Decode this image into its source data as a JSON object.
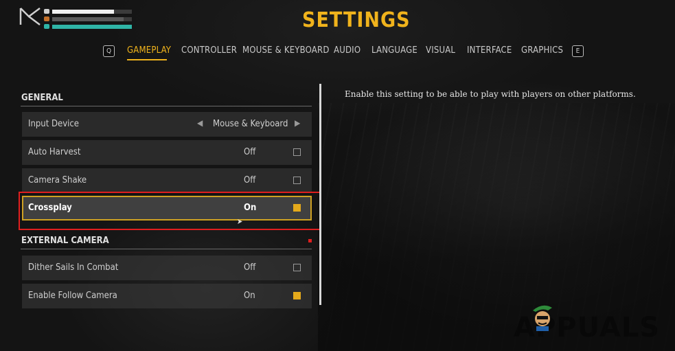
{
  "title": "SETTINGS",
  "tabs": {
    "prev_key": "Q",
    "next_key": "E",
    "items": [
      "GAMEPLAY",
      "CONTROLLER",
      "MOUSE & KEYBOARD",
      "AUDIO",
      "LANGUAGE",
      "VISUAL",
      "INTERFACE",
      "GRAPHICS"
    ],
    "active": "GAMEPLAY"
  },
  "sections": [
    {
      "header": "GENERAL",
      "rows": [
        {
          "label": "Input Device",
          "value": "Mouse & Keyboard",
          "type": "selector"
        },
        {
          "label": "Auto Harvest",
          "value": "Off",
          "type": "toggle",
          "checked": false
        },
        {
          "label": "Camera Shake",
          "value": "Off",
          "type": "toggle",
          "checked": false
        },
        {
          "label": "Crossplay",
          "value": "On",
          "type": "toggle",
          "checked": true,
          "selected": true
        }
      ]
    },
    {
      "header": "EXTERNAL CAMERA",
      "rows": [
        {
          "label": "Dither Sails In Combat",
          "value": "Off",
          "type": "toggle",
          "checked": false
        },
        {
          "label": "Enable Follow Camera",
          "value": "On",
          "type": "toggle",
          "checked": true
        }
      ]
    }
  ],
  "description": "Enable this setting to be able to play with players on other platforms.",
  "hud": {
    "health_fraction": 0.78,
    "stamina_fraction": 0.9,
    "energy_fraction": 1.0
  },
  "watermark": "APPUALS",
  "colors": {
    "accent": "#f0b31c",
    "highlight": "#e01f1f",
    "toggle_on": "#e4a91b"
  },
  "icons": {
    "prev": "chevron-left-icon",
    "next": "chevron-right-icon",
    "cursor": "mouse-cursor-icon"
  }
}
